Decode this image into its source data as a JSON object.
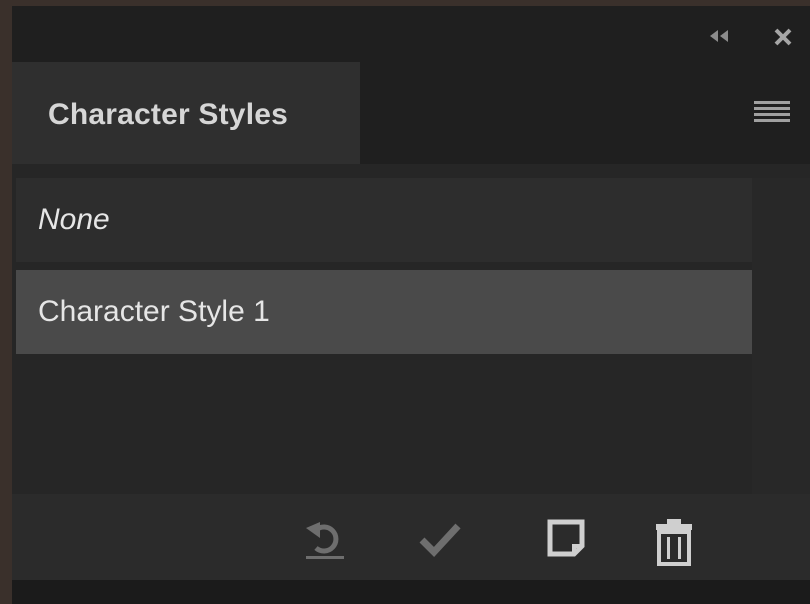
{
  "panel": {
    "title": "Character Styles",
    "collapse_icon": "double-chevron-left-icon",
    "close_icon": "close-icon",
    "menu_icon": "hamburger-menu-icon"
  },
  "styles_list": {
    "items": [
      {
        "label": "None",
        "italic": true,
        "selected": false
      },
      {
        "label": "Character Style 1",
        "italic": false,
        "selected": true
      }
    ]
  },
  "footer": {
    "buttons": [
      {
        "name": "clear-overrides-button",
        "icon": "undo-arrow-icon",
        "enabled": false
      },
      {
        "name": "redefine-style-button",
        "icon": "checkmark-icon",
        "enabled": false
      },
      {
        "name": "new-style-button",
        "icon": "new-page-icon",
        "enabled": true
      },
      {
        "name": "delete-style-button",
        "icon": "trash-icon",
        "enabled": true
      }
    ]
  },
  "colors": {
    "panel_bg": "#262626",
    "selected_row": "#4a4a4a",
    "text": "#e6e6e6",
    "disabled_icon": "#6e6e6e",
    "enabled_icon": "#cfcfcf"
  }
}
